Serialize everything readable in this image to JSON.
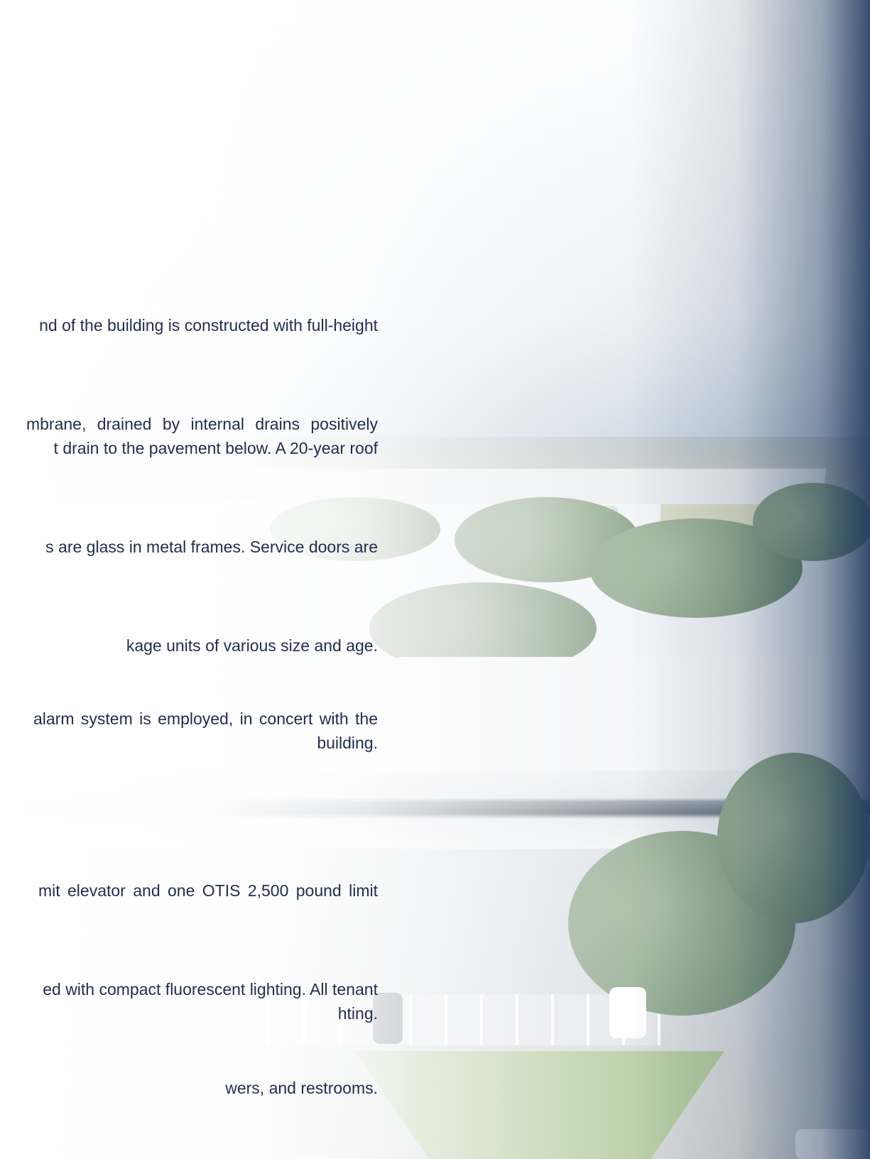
{
  "colors": {
    "text": "#1f2d4f",
    "accent_navy": "#223a5f"
  },
  "paragraphs": [
    {
      "lines": [
        "nd of the building is constructed with full-height"
      ]
    },
    {
      "lines": [
        "mbrane, drained by internal drains positively",
        "t drain to the pavement below. A 20-year roof"
      ]
    },
    {
      "lines": [
        "s are glass in metal frames. Service doors are"
      ]
    },
    {
      "lines": [
        "kage units of various size and age."
      ]
    },
    {
      "lines": [
        "alarm system is employed, in concert with the",
        "building."
      ]
    },
    {
      "lines": [
        "mit elevator and one OTIS 2,500 pound limit"
      ]
    },
    {
      "lines": [
        "ed with compact fluorescent lighting. All tenant",
        "hting."
      ]
    },
    {
      "lines": [
        "wers, and restrooms."
      ]
    }
  ]
}
